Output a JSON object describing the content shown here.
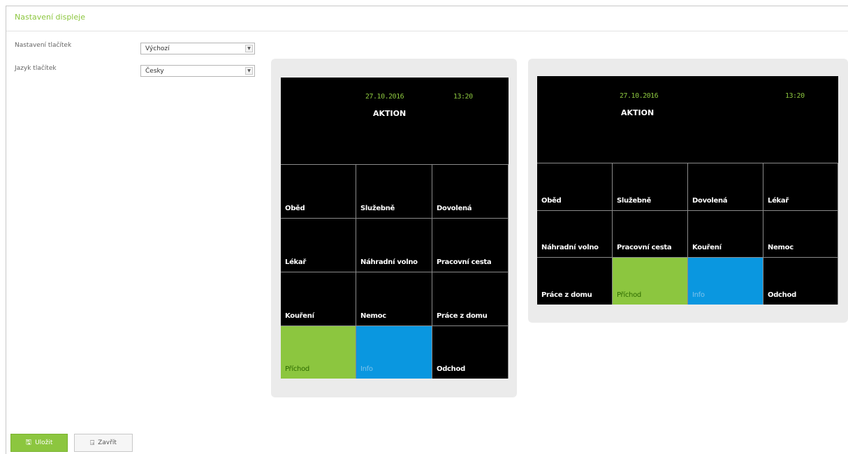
{
  "panel": {
    "title": "Nastavení displeje"
  },
  "form": {
    "rows": [
      {
        "label": "Nastavení tlačítek",
        "value": "Výchozí"
      },
      {
        "label": "Jazyk tlačítek",
        "value": "Česky"
      }
    ]
  },
  "colors": {
    "accent": "#8cc63f",
    "blue": "#0a97e0",
    "screen": "#000000"
  },
  "previews": [
    {
      "date": "27.10.2016",
      "time": "13:20",
      "brand": "AKTION",
      "tiles": [
        "Oběd",
        "Služebně",
        "Dovolená",
        "Lékař",
        "Náhradní volno",
        "Pracovní cesta",
        "Kouření",
        "Nemoc",
        "Práce z domu",
        "Příchod",
        "Info",
        "Odchod"
      ]
    },
    {
      "date": "27.10.2016",
      "time": "13:20",
      "brand": "AKTION",
      "tiles": [
        "Oběd",
        "Služebně",
        "Dovolená",
        "Lékař",
        "Náhradní volno",
        "Pracovní cesta",
        "Kouření",
        "Nemoc",
        "Práce z domu",
        "Příchod",
        "Info",
        "Odchod"
      ]
    }
  ],
  "buttons": {
    "save": {
      "label": "Uložit",
      "icon": "floppy-icon"
    },
    "close": {
      "label": "Zavřít",
      "icon": "door-exit-icon"
    }
  }
}
